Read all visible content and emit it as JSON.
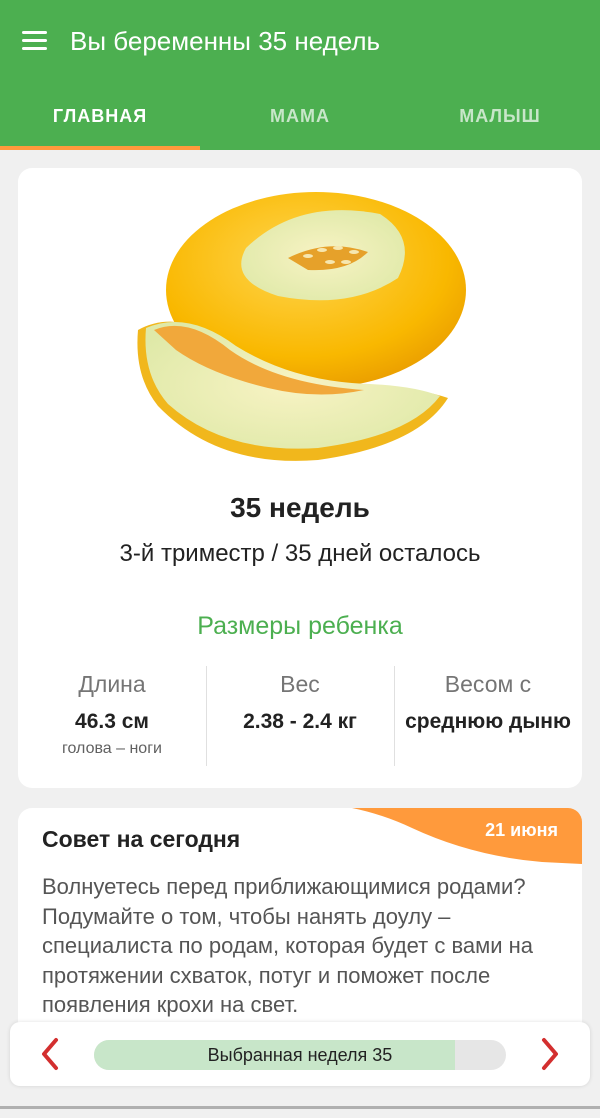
{
  "app": {
    "title": "Вы беременны 35 недель",
    "menu_icon": "menu-icon",
    "accent_color": "#4caf50",
    "indicator_color": "#ff9a3c"
  },
  "tabs": [
    {
      "label": "ГЛАВНАЯ",
      "active": true
    },
    {
      "label": "МАМА",
      "active": false
    },
    {
      "label": "МАЛЫШ",
      "active": false
    }
  ],
  "main": {
    "image": "melon-illustration",
    "week_title": "35 недель",
    "subtitle": "3-й триместр / 35 дней осталось",
    "sizes_heading": "Размеры ребенка",
    "stats": [
      {
        "label": "Длина",
        "value": "46.3 см",
        "note": "голова – ноги"
      },
      {
        "label": "Вес",
        "value": "2.38 - 2.4 кг"
      },
      {
        "label": "Весом с",
        "value": "среднюю дыню"
      }
    ]
  },
  "tip": {
    "title": "Совет на сегодня",
    "date": "21 июня",
    "text": "Волнуетесь перед приближающимися родами? Подумайте о том, чтобы нанять доулу – специалиста по родам, которая будет с вами на протяжении схваток, потуг и поможет после появления крохи на свет."
  },
  "bottom_nav": {
    "prev_icon": "chevron-left-icon",
    "next_icon": "chevron-right-icon",
    "selected_label": "Выбранная неделя 35",
    "week_progress": 0.875
  }
}
